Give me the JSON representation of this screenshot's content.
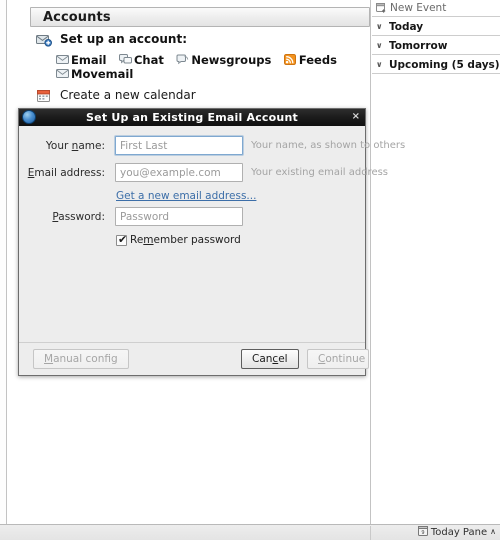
{
  "window": {
    "content_header": "Accounts"
  },
  "accounts_pane": {
    "setup": {
      "icon": "mail-add-icon",
      "title": "Set up an account:",
      "links": [
        {
          "label": "Email",
          "icon": "envelope-icon"
        },
        {
          "label": "Chat",
          "icon": "chat-icon"
        },
        {
          "label": "Newsgroups",
          "icon": "newsgroup-icon"
        },
        {
          "label": "Feeds",
          "icon": "rss-icon"
        },
        {
          "label": "Movemail",
          "icon": "envelope-icon"
        }
      ]
    },
    "calendar": {
      "icon": "calendar-icon",
      "title": "Create a new calendar"
    }
  },
  "dialog": {
    "title": "Set Up an Existing Email Account",
    "app_icon": "thunderbird-icon",
    "close_label": "×",
    "fields": [
      {
        "label_pre": "Your ",
        "label_mnemonic": "n",
        "label_post": "ame:",
        "name": "your-name",
        "value": "",
        "placeholder": "First Last",
        "hint": "Your name, as shown to others",
        "focused": true,
        "type": "text"
      },
      {
        "label_pre": "",
        "label_mnemonic": "E",
        "label_post": "mail address:",
        "name": "email-address",
        "value": "",
        "placeholder": "you@example.com",
        "hint": "Your existing email address",
        "focused": false,
        "type": "text"
      },
      {
        "label_pre": "",
        "label_mnemonic": "P",
        "label_post": "assword:",
        "name": "password",
        "value": "",
        "placeholder": "Password",
        "hint": "",
        "focused": false,
        "type": "password"
      }
    ],
    "get_new_address_link": "Get a new email address...",
    "remember_password": {
      "label_pre": "Re",
      "label_mnemonic": "m",
      "label_post": "ember password",
      "checked": true,
      "check_glyph": "✔"
    },
    "buttons": {
      "manual": {
        "label_pre": "",
        "label_mnemonic": "M",
        "label_post": "anual config",
        "disabled": true,
        "default": false
      },
      "cancel": {
        "label_pre": "Can",
        "label_mnemonic": "c",
        "label_post": "el",
        "disabled": false,
        "default": true
      },
      "continue": {
        "label_pre": "",
        "label_mnemonic": "C",
        "label_post": "ontinue",
        "disabled": true,
        "default": false
      }
    }
  },
  "today_pane": {
    "new_event": {
      "label": "New Event",
      "icon": "new-event-icon"
    },
    "groups": [
      {
        "label": "Today",
        "twisty": "∨"
      },
      {
        "label": "Tomorrow",
        "twisty": "∨"
      },
      {
        "label": "Upcoming (5 days)",
        "twisty": "∨"
      }
    ]
  },
  "statusbar": {
    "today_pane_label": "Today Pane",
    "today_pane_icon": "calendar-small-icon",
    "caret": "∧"
  },
  "colors": {
    "link": "#3c6ea8",
    "rss_orange": "#f08a24",
    "titlebar": "#171717",
    "focus_border": "#7fa8d0"
  }
}
